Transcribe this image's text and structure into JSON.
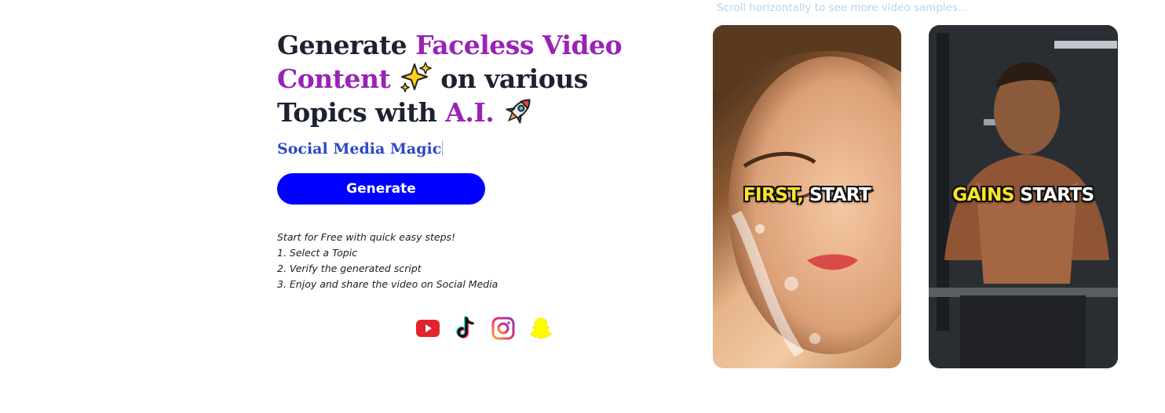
{
  "hero": {
    "title_part1": "Generate ",
    "title_accent1": "Faceless Video Content",
    "title_part2": " on various Topics with ",
    "title_accent2": "A.I.",
    "emoji1": "sparkles-emoji",
    "emoji2": "rocket-emoji",
    "typed_text": "Social Media Magic",
    "generate_label": "Generate"
  },
  "steps": {
    "intro": "Start for Free with quick easy steps!",
    "items": [
      "1. Select a Topic",
      "2. Verify the generated script",
      "3. Enjoy and share the video on Social Media"
    ]
  },
  "socials": [
    {
      "icon": "youtube-icon"
    },
    {
      "icon": "tiktok-icon"
    },
    {
      "icon": "instagram-icon"
    },
    {
      "icon": "snapchat-icon"
    }
  ],
  "samples": {
    "hint": "Scroll horizontally to see more video samples...",
    "cards": [
      {
        "highlight": "FIRST,",
        "rest": " START"
      },
      {
        "highlight": "GAINS",
        "rest": " STARTS"
      }
    ]
  },
  "colors": {
    "accent_purple": "#9a22b6",
    "typed_blue": "#2c47c8",
    "button_blue": "#0000ff",
    "caption_yellow": "#ffe428"
  }
}
